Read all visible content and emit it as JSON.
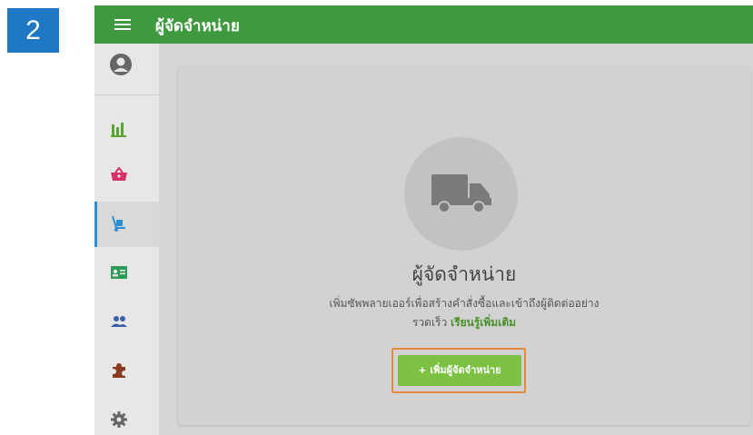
{
  "step_badge": "2",
  "header": {
    "title": "ผู้จัดจำหน่าย"
  },
  "sidebar": {
    "items": [
      {
        "name": "profile",
        "icon": "user-circle-icon"
      },
      {
        "name": "reports",
        "icon": "bar-chart-icon"
      },
      {
        "name": "sales",
        "icon": "shopping-basket-icon"
      },
      {
        "name": "purchasing",
        "icon": "hand-truck-icon",
        "active": true
      },
      {
        "name": "contacts",
        "icon": "id-card-icon"
      },
      {
        "name": "customers",
        "icon": "users-icon"
      },
      {
        "name": "addons",
        "icon": "puzzle-icon"
      },
      {
        "name": "settings",
        "icon": "gear-icon"
      }
    ]
  },
  "empty_state": {
    "icon": "truck-icon",
    "title": "ผู้จัดจำหน่าย",
    "description_line1": "เพิ่มซัพพลายเออร์เพื่อสร้างคำสั่งซื้อและเข้าถึงผู้ติดต่ออย่าง",
    "description_line2": "รวดเร็ว",
    "learn_more": "เรียนรู้เพิ่มเติม",
    "add_button": "+ เพิ่มผู้จัดจำหน่าย"
  },
  "colors": {
    "header": "#3f9a3f",
    "accent_blue": "#1f78c6",
    "button_green": "#7dc142",
    "highlight_orange": "#e58a3a"
  }
}
